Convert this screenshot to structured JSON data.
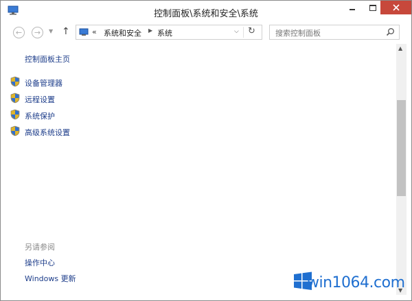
{
  "window": {
    "title": "控制面板\\系统和安全\\系统"
  },
  "nav": {
    "back_icon": "←",
    "forward_icon": "→",
    "history_icon": "▼",
    "up_icon": "↑"
  },
  "address": {
    "overflow": "«",
    "crumb1": "系统和安全",
    "sep": "▶",
    "crumb2": "系统",
    "dropdown": "⌵",
    "refresh_icon": "↻"
  },
  "search": {
    "placeholder": "搜索控制面板"
  },
  "sidebar": {
    "home": "控制面板主页",
    "tasks": [
      {
        "label": "设备管理器"
      },
      {
        "label": "远程设置"
      },
      {
        "label": "系统保护"
      },
      {
        "label": "高级系统设置"
      }
    ],
    "see_also": "另请参阅",
    "links": [
      {
        "label": "操作中心"
      },
      {
        "label": "Windows 更新"
      }
    ]
  },
  "watermark": {
    "text": "win1064.com"
  },
  "colors": {
    "link": "#1d3d8a",
    "close_button": "#c7483b",
    "watermark": "#1f6fd0"
  },
  "icons": {
    "app": "computer-icon",
    "task": "shield-icon",
    "search": "magnifier-icon"
  }
}
